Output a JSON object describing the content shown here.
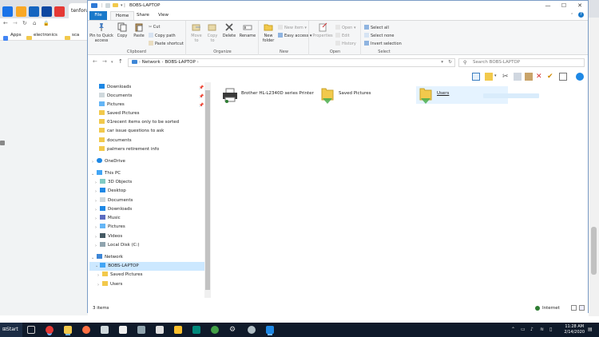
{
  "browser": {
    "tab_title": "tenforu",
    "bookmarks": [
      "Apps",
      "electronics",
      "sca"
    ]
  },
  "explorer": {
    "title": "BOBS-LAPTOP",
    "ribbon_tabs": [
      "File",
      "Home",
      "Share",
      "View"
    ],
    "clipboard": {
      "pin": "Pin to Quick access",
      "copy": "Copy",
      "paste": "Paste",
      "cut": "Cut",
      "copy_path": "Copy path",
      "paste_shortcut": "Paste shortcut",
      "group": "Clipboard"
    },
    "organize": {
      "move_to": "Move to",
      "copy_to": "Copy to",
      "delete": "Delete",
      "rename": "Rename",
      "group": "Organize"
    },
    "new": {
      "new_folder": "New folder",
      "new_item": "New item",
      "easy_access": "Easy access",
      "group": "New"
    },
    "open": {
      "properties": "Properties",
      "open": "Open",
      "edit": "Edit",
      "history": "History",
      "group": "Open"
    },
    "select": {
      "select_all": "Select all",
      "select_none": "Select none",
      "invert": "Invert selection",
      "group": "Select"
    },
    "address": {
      "segments": [
        "Network",
        "BOBS-LAPTOP"
      ],
      "search_placeholder": "Search BOBS-LAPTOP"
    },
    "nav": {
      "quick_access": [
        "Downloads",
        "Documents",
        "Pictures",
        "Saved Pictures",
        "01recent items only to be sorted",
        "car issue questions to ask",
        "documents",
        "palmers retirement info"
      ],
      "onedrive": "OneDrive",
      "this_pc": "This PC",
      "this_pc_items": [
        "3D Objects",
        "Desktop",
        "Documents",
        "Downloads",
        "Music",
        "Pictures",
        "Videos",
        "Local Disk (C:)"
      ],
      "network": "Network",
      "computer": "BOBS-LAPTOP",
      "computer_items": [
        "Saved Pictures",
        "Users"
      ]
    },
    "items": [
      "Brother HL-L2340D series Printer",
      "Saved Pictures",
      "Users"
    ],
    "status": {
      "count": "3 items",
      "zone": "Internet"
    }
  },
  "taskbar": {
    "start": "Start",
    "time": "11:28 AM",
    "date": "2/14/2020"
  },
  "colors": {
    "accent": "#1979ca",
    "selection": "#cce8ff",
    "folder": "#f2c94c"
  }
}
